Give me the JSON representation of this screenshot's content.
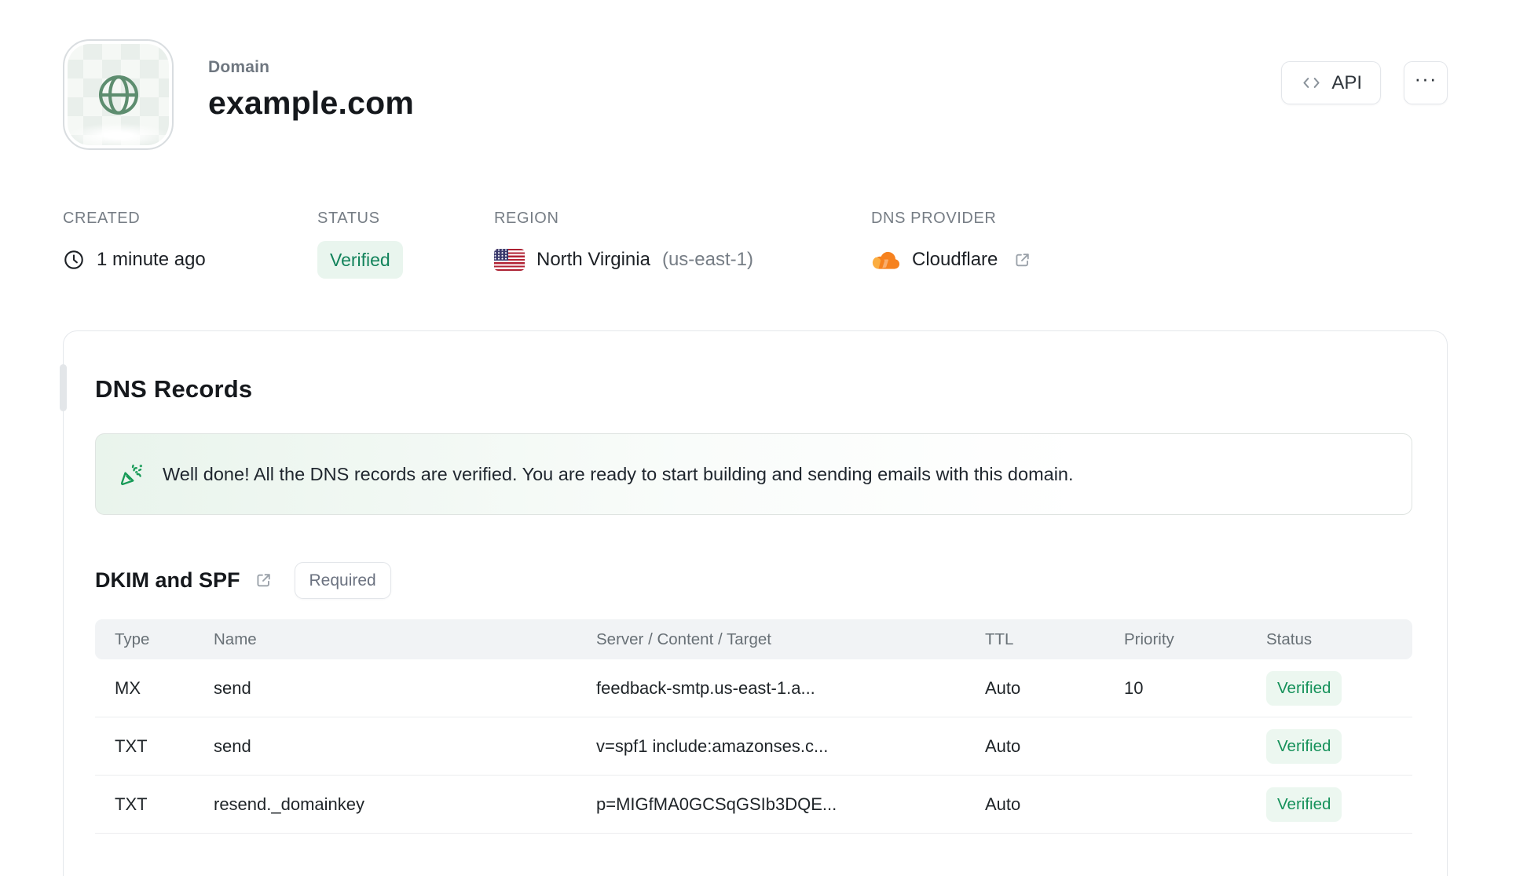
{
  "header": {
    "label": "Domain",
    "title": "example.com",
    "api_button": "API",
    "more_button": "···"
  },
  "meta": {
    "created": {
      "label": "CREATED",
      "value": "1 minute ago"
    },
    "status": {
      "label": "STATUS",
      "value": "Verified"
    },
    "region": {
      "label": "REGION",
      "name": "North Virginia",
      "code": "(us-east-1)"
    },
    "dns_provider": {
      "label": "DNS PROVIDER",
      "value": "Cloudflare"
    }
  },
  "dns_records": {
    "title": "DNS Records",
    "banner_message": "Well done! All the DNS records are verified. You are ready to start building and sending emails with this domain.",
    "section": {
      "title": "DKIM and SPF",
      "badge": "Required"
    },
    "table": {
      "headers": [
        "Type",
        "Name",
        "Server / Content / Target",
        "TTL",
        "Priority",
        "Status"
      ],
      "rows": [
        {
          "type": "MX",
          "name": "send",
          "content": "feedback-smtp.us-east-1.a...",
          "ttl": "Auto",
          "priority": "10",
          "status": "Verified"
        },
        {
          "type": "TXT",
          "name": "send",
          "content": "v=spf1 include:amazonses.c...",
          "ttl": "Auto",
          "priority": "",
          "status": "Verified"
        },
        {
          "type": "TXT",
          "name": "resend._domainkey",
          "content": "p=MIGfMA0GCSqGSIb3DQE...",
          "ttl": "Auto",
          "priority": "",
          "status": "Verified"
        }
      ]
    }
  },
  "colors": {
    "status_green_text": "#12835b",
    "status_green_bg": "#e9f5ee",
    "cloudflare_orange": "#f6821f",
    "cloudflare_orange_light": "#fbad41",
    "globe_green": "#5d8d6f",
    "banner_green": "#179a57"
  }
}
